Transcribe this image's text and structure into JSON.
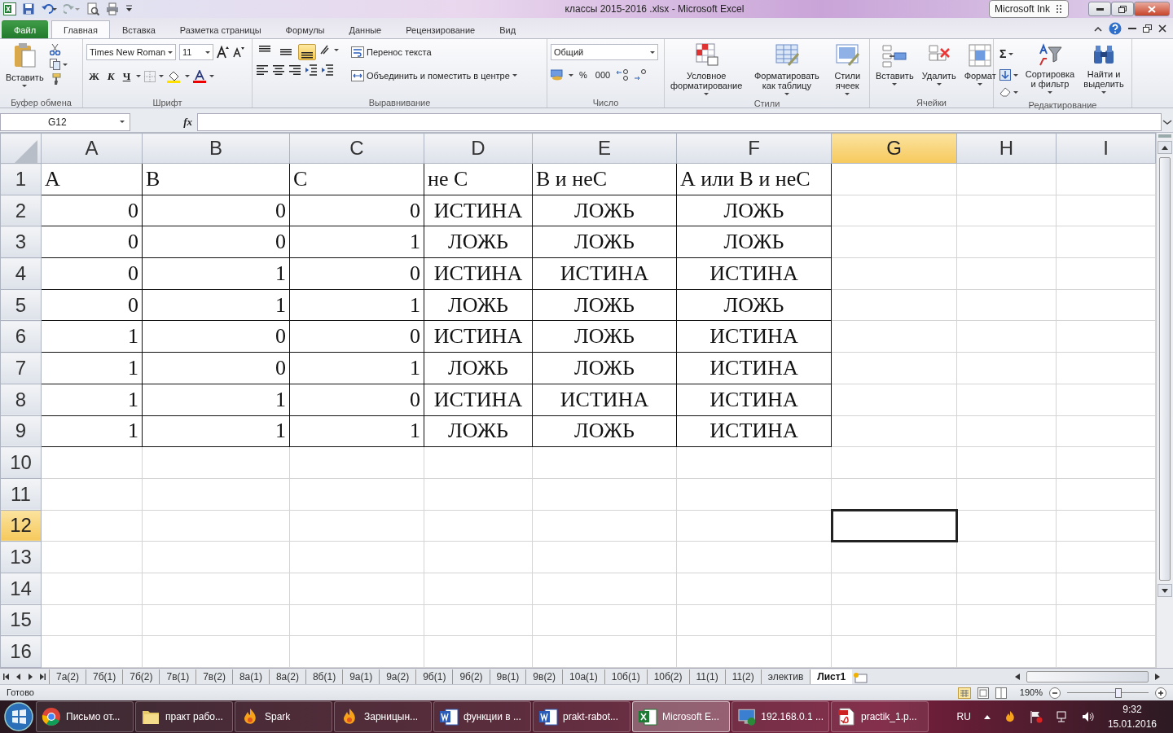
{
  "window": {
    "title": "классы 2015-2016 .xlsx  -  Microsoft Excel",
    "ink_panel": "Microsoft Ink"
  },
  "ribbon_tabs": [
    {
      "label": "Файл",
      "kind": "file",
      "selected": false
    },
    {
      "label": "Главная",
      "kind": "tab",
      "selected": true
    },
    {
      "label": "Вставка",
      "kind": "tab",
      "selected": false
    },
    {
      "label": "Разметка страницы",
      "kind": "tab",
      "selected": false
    },
    {
      "label": "Формулы",
      "kind": "tab",
      "selected": false
    },
    {
      "label": "Данные",
      "kind": "tab",
      "selected": false
    },
    {
      "label": "Рецензирование",
      "kind": "tab",
      "selected": false
    },
    {
      "label": "Вид",
      "kind": "tab",
      "selected": false
    }
  ],
  "ribbon_groups": [
    {
      "label": "Буфер обмена",
      "kind": "clipboard",
      "buttons": [
        "Вставить"
      ]
    },
    {
      "label": "Шрифт",
      "kind": "font",
      "font_name": "Times New Roman",
      "font_size": "11",
      "buttons": [
        "Ж",
        "К",
        "Ч"
      ]
    },
    {
      "label": "Выравнивание",
      "kind": "alignment",
      "vertical_align": [
        {
          "selected": false
        },
        {
          "selected": false
        },
        {
          "selected": true
        }
      ],
      "buttons": [
        "Перенос текста",
        "Объединить и поместить в центре"
      ]
    },
    {
      "label": "Число",
      "kind": "number",
      "format": "Общий",
      "buttons": [
        "%",
        "000"
      ]
    },
    {
      "label": "Стили",
      "kind": "large",
      "buttons": [
        "Условное форматирование",
        "Форматировать как таблицу",
        "Стили ячеек"
      ]
    },
    {
      "label": "Ячейки",
      "kind": "large",
      "buttons": [
        "Вставить",
        "Удалить",
        "Формат"
      ]
    },
    {
      "label": "Редактирование",
      "kind": "editing",
      "sum": "Σ",
      "buttons": [
        "Сортировка и фильтр",
        "Найти и выделить"
      ]
    }
  ],
  "formula_bar": {
    "name_box": "G12",
    "function_label": "fx"
  },
  "columns": [
    {
      "label": "A",
      "selected": false
    },
    {
      "label": "B",
      "selected": false
    },
    {
      "label": "C",
      "selected": false
    },
    {
      "label": "D",
      "selected": false
    },
    {
      "label": "E",
      "selected": false
    },
    {
      "label": "F",
      "selected": false
    },
    {
      "label": "G",
      "selected": true
    },
    {
      "label": "H",
      "selected": false
    },
    {
      "label": "I",
      "selected": false
    }
  ],
  "rows": [
    {
      "label": "1",
      "selected": false,
      "cells": [
        {
          "text": "А",
          "kind": "text"
        },
        {
          "text": "В",
          "kind": "text"
        },
        {
          "text": "С",
          "kind": "text"
        },
        {
          "text": "не С",
          "kind": "text"
        },
        {
          "text": "В и неС",
          "kind": "text"
        },
        {
          "text": "А или В и неС",
          "kind": "text"
        }
      ]
    },
    {
      "label": "2",
      "selected": false,
      "cells": [
        {
          "text": "0",
          "kind": "number"
        },
        {
          "text": "0",
          "kind": "number"
        },
        {
          "text": "0",
          "kind": "number"
        },
        {
          "text": "ИСТИНА",
          "kind": "logical"
        },
        {
          "text": "ЛОЖЬ",
          "kind": "logical"
        },
        {
          "text": "ЛОЖЬ",
          "kind": "logical"
        }
      ]
    },
    {
      "label": "3",
      "selected": false,
      "cells": [
        {
          "text": "0",
          "kind": "number"
        },
        {
          "text": "0",
          "kind": "number"
        },
        {
          "text": "1",
          "kind": "number"
        },
        {
          "text": "ЛОЖЬ",
          "kind": "logical"
        },
        {
          "text": "ЛОЖЬ",
          "kind": "logical"
        },
        {
          "text": "ЛОЖЬ",
          "kind": "logical"
        }
      ]
    },
    {
      "label": "4",
      "selected": false,
      "cells": [
        {
          "text": "0",
          "kind": "number"
        },
        {
          "text": "1",
          "kind": "number"
        },
        {
          "text": "0",
          "kind": "number"
        },
        {
          "text": "ИСТИНА",
          "kind": "logical"
        },
        {
          "text": "ИСТИНА",
          "kind": "logical"
        },
        {
          "text": "ИСТИНА",
          "kind": "logical"
        }
      ]
    },
    {
      "label": "5",
      "selected": false,
      "cells": [
        {
          "text": "0",
          "kind": "number"
        },
        {
          "text": "1",
          "kind": "number"
        },
        {
          "text": "1",
          "kind": "number"
        },
        {
          "text": "ЛОЖЬ",
          "kind": "logical"
        },
        {
          "text": "ЛОЖЬ",
          "kind": "logical"
        },
        {
          "text": "ЛОЖЬ",
          "kind": "logical"
        }
      ]
    },
    {
      "label": "6",
      "selected": false,
      "cells": [
        {
          "text": "1",
          "kind": "number"
        },
        {
          "text": "0",
          "kind": "number"
        },
        {
          "text": "0",
          "kind": "number"
        },
        {
          "text": "ИСТИНА",
          "kind": "logical"
        },
        {
          "text": "ЛОЖЬ",
          "kind": "logical"
        },
        {
          "text": "ИСТИНА",
          "kind": "logical"
        }
      ]
    },
    {
      "label": "7",
      "selected": false,
      "cells": [
        {
          "text": "1",
          "kind": "number"
        },
        {
          "text": "0",
          "kind": "number"
        },
        {
          "text": "1",
          "kind": "number"
        },
        {
          "text": "ЛОЖЬ",
          "kind": "logical"
        },
        {
          "text": "ЛОЖЬ",
          "kind": "logical"
        },
        {
          "text": "ИСТИНА",
          "kind": "logical"
        }
      ]
    },
    {
      "label": "8",
      "selected": false,
      "cells": [
        {
          "text": "1",
          "kind": "number"
        },
        {
          "text": "1",
          "kind": "number"
        },
        {
          "text": "0",
          "kind": "number"
        },
        {
          "text": "ИСТИНА",
          "kind": "logical"
        },
        {
          "text": "ИСТИНА",
          "kind": "logical"
        },
        {
          "text": "ИСТИНА",
          "kind": "logical"
        }
      ]
    },
    {
      "label": "9",
      "selected": false,
      "cells": [
        {
          "text": "1",
          "kind": "number"
        },
        {
          "text": "1",
          "kind": "number"
        },
        {
          "text": "1",
          "kind": "number"
        },
        {
          "text": "ЛОЖЬ",
          "kind": "logical"
        },
        {
          "text": "ЛОЖЬ",
          "kind": "logical"
        },
        {
          "text": "ИСТИНА",
          "kind": "logical"
        }
      ]
    },
    {
      "label": "10",
      "selected": false
    },
    {
      "label": "11",
      "selected": false
    },
    {
      "label": "12",
      "selected": true
    },
    {
      "label": "13",
      "selected": false
    },
    {
      "label": "14",
      "selected": false
    },
    {
      "label": "15",
      "selected": false
    },
    {
      "label": "16",
      "selected": false
    }
  ],
  "sheet_tabs": [
    {
      "label": "7а(2)",
      "selected": false
    },
    {
      "label": "7б(1)",
      "selected": false
    },
    {
      "label": "7б(2)",
      "selected": false
    },
    {
      "label": "7в(1)",
      "selected": false
    },
    {
      "label": "7в(2)",
      "selected": false
    },
    {
      "label": "8а(1)",
      "selected": false
    },
    {
      "label": "8а(2)",
      "selected": false
    },
    {
      "label": "8б(1)",
      "selected": false
    },
    {
      "label": "9а(1)",
      "selected": false
    },
    {
      "label": "9а(2)",
      "selected": false
    },
    {
      "label": "9б(1)",
      "selected": false
    },
    {
      "label": "9б(2)",
      "selected": false
    },
    {
      "label": "9в(1)",
      "selected": false
    },
    {
      "label": "9в(2)",
      "selected": false
    },
    {
      "label": "10а(1)",
      "selected": false
    },
    {
      "label": "10б(1)",
      "selected": false
    },
    {
      "label": "10б(2)",
      "selected": false
    },
    {
      "label": "11(1)",
      "selected": false
    },
    {
      "label": "11(2)",
      "selected": false
    },
    {
      "label": "электив",
      "selected": false
    },
    {
      "label": "Лист1",
      "selected": true
    }
  ],
  "status_bar": {
    "status": "Готово",
    "zoom": "190%",
    "zoom_slider": {
      "level": 0.64
    }
  },
  "taskbar": {
    "items": [
      {
        "label": "Письмо от...",
        "kind": "browser",
        "selected": false
      },
      {
        "label": "практ рабо...",
        "kind": "folder",
        "selected": false
      },
      {
        "label": "Spark",
        "kind": "spark",
        "selected": false
      },
      {
        "label": "Зарницын...",
        "kind": "spark",
        "selected": false
      },
      {
        "label": "функции в ...",
        "kind": "word",
        "selected": false
      },
      {
        "label": "prakt-rabot...",
        "kind": "word",
        "selected": false
      },
      {
        "label": "Microsoft E...",
        "kind": "excel",
        "selected": true
      },
      {
        "label": "192.168.0.1 ...",
        "kind": "remote",
        "selected": false
      },
      {
        "label": "practik_1.p...",
        "kind": "pdf",
        "selected": false
      }
    ],
    "language": "RU",
    "time": "9:32",
    "date": "15.01.2016"
  }
}
